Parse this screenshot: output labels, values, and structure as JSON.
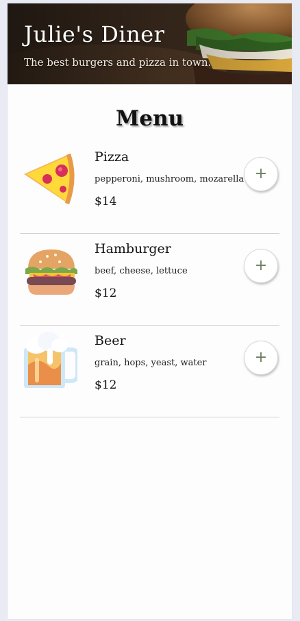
{
  "header": {
    "title": "Julie's Diner",
    "subtitle": "The best burgers and pizza in town."
  },
  "menu": {
    "heading": "Menu",
    "items": [
      {
        "name": "Pizza",
        "description": "pepperoni, mushroom, mozarella",
        "price": "$14",
        "icon": "pizza-icon",
        "add_label": "+"
      },
      {
        "name": "Hamburger",
        "description": "beef, cheese, lettuce",
        "price": "$12",
        "icon": "hamburger-icon",
        "add_label": "+"
      },
      {
        "name": "Beer",
        "description": "grain, hops, yeast, water",
        "price": "$12",
        "icon": "beer-icon",
        "add_label": "+"
      }
    ]
  },
  "colors": {
    "page_background": "#e9ebf4",
    "card_background": "#fdfdfe",
    "add_button_plus": "#6f7f62"
  }
}
